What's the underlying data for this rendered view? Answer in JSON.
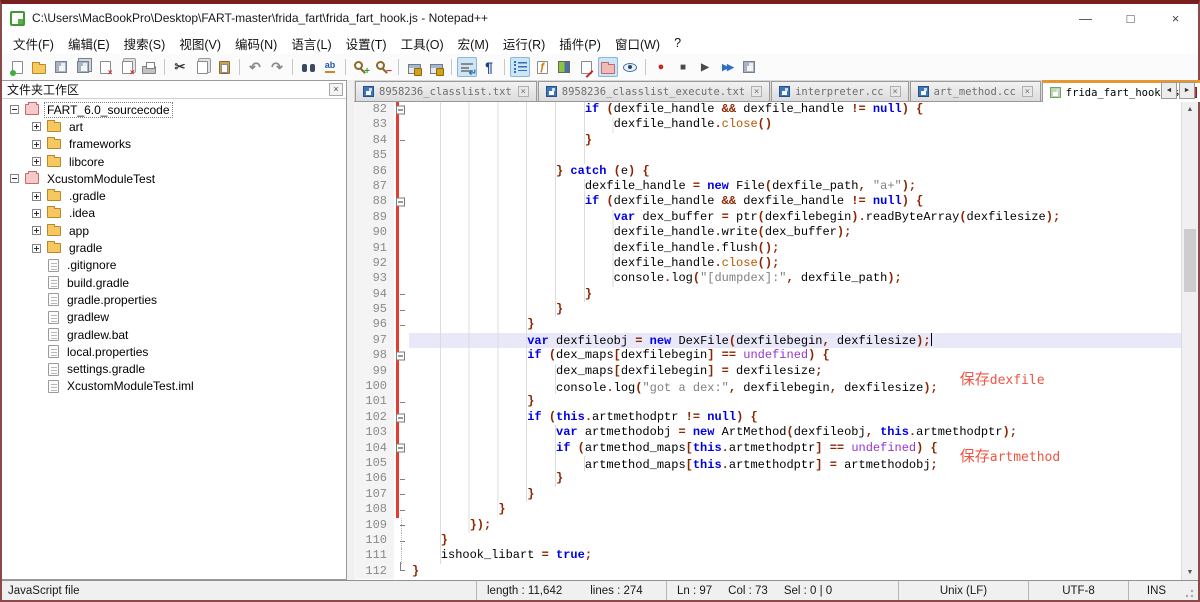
{
  "window": {
    "title": "C:\\Users\\MacBookPro\\Desktop\\FART-master\\frida_fart\\frida_fart_hook.js - Notepad++",
    "minimize": "—",
    "maximize": "□",
    "close": "×"
  },
  "menu": [
    "文件(F)",
    "编辑(E)",
    "搜索(S)",
    "视图(V)",
    "编码(N)",
    "语言(L)",
    "设置(T)",
    "工具(O)",
    "宏(M)",
    "运行(R)",
    "插件(P)",
    "窗口(W)",
    "?"
  ],
  "toolbar": [
    {
      "name": "new-file"
    },
    {
      "name": "open-file"
    },
    {
      "name": "save"
    },
    {
      "name": "save-all"
    },
    {
      "name": "close-file"
    },
    {
      "name": "close-all"
    },
    {
      "name": "print",
      "sep": true
    },
    {
      "name": "cut"
    },
    {
      "name": "copy"
    },
    {
      "name": "paste",
      "sep": true
    },
    {
      "name": "undo"
    },
    {
      "name": "redo",
      "sep": true
    },
    {
      "name": "find"
    },
    {
      "name": "replace",
      "sep": true
    },
    {
      "name": "zoom-in"
    },
    {
      "name": "zoom-out",
      "sep": true
    },
    {
      "name": "sync-vertical"
    },
    {
      "name": "sync-horizontal",
      "sep": true
    },
    {
      "name": "word-wrap",
      "active": true
    },
    {
      "name": "show-all-characters",
      "sep": true
    },
    {
      "name": "indent-guide",
      "active": true
    },
    {
      "name": "function-list"
    },
    {
      "name": "document-map"
    },
    {
      "name": "document-list"
    },
    {
      "name": "folder-as-workspace",
      "active": true
    },
    {
      "name": "monitoring",
      "sep": true
    },
    {
      "name": "macro-record"
    },
    {
      "name": "macro-stop"
    },
    {
      "name": "macro-playback"
    },
    {
      "name": "macro-run-multiple"
    },
    {
      "name": "macro-save"
    }
  ],
  "panel": {
    "title": "文件夹工作区",
    "close": "×",
    "tree": [
      {
        "label": "FART_6.0_sourcecode",
        "type": "root",
        "expand": "minus",
        "focused": true
      },
      {
        "label": "art",
        "type": "folder",
        "expand": "plus"
      },
      {
        "label": "frameworks",
        "type": "folder",
        "expand": "plus"
      },
      {
        "label": "libcore",
        "type": "folder",
        "expand": "plus"
      },
      {
        "label": "XcustomModuleTest",
        "type": "root",
        "expand": "minus"
      },
      {
        "label": ".gradle",
        "type": "folder",
        "expand": "plus"
      },
      {
        "label": ".idea",
        "type": "folder",
        "expand": "plus"
      },
      {
        "label": "app",
        "type": "folder",
        "expand": "plus"
      },
      {
        "label": "gradle",
        "type": "folder",
        "expand": "plus"
      },
      {
        "label": ".gitignore",
        "type": "file"
      },
      {
        "label": "build.gradle",
        "type": "file"
      },
      {
        "label": "gradle.properties",
        "type": "file"
      },
      {
        "label": "gradlew",
        "type": "file"
      },
      {
        "label": "gradlew.bat",
        "type": "file"
      },
      {
        "label": "local.properties",
        "type": "file"
      },
      {
        "label": "settings.gradle",
        "type": "file"
      },
      {
        "label": "XcustomModuleTest.iml",
        "type": "file"
      }
    ]
  },
  "tabs": {
    "items": [
      {
        "label": "8958236_classlist.txt"
      },
      {
        "label": "8958236_classlist_execute.txt"
      },
      {
        "label": "interpreter.cc"
      },
      {
        "label": "art_method.cc"
      },
      {
        "label": "frida_fart_hook.js",
        "active": true
      }
    ],
    "scroll_left": "◄",
    "scroll_right": "►",
    "close_glyph": "×"
  },
  "editor": {
    "lines": [
      {
        "n": 82,
        "i": 24,
        "f": "box",
        "r": true,
        "seg": [
          [
            "k",
            "if"
          ],
          [
            "d",
            " "
          ],
          [
            "o",
            "("
          ],
          [
            "d",
            "dexfile_handle "
          ],
          [
            "o",
            "&&"
          ],
          [
            "d",
            " dexfile_handle "
          ],
          [
            "o",
            "!="
          ],
          [
            "d",
            " "
          ],
          [
            "k",
            "null"
          ],
          [
            "o",
            ")"
          ],
          [
            "d",
            " "
          ],
          [
            "o",
            "{"
          ]
        ]
      },
      {
        "n": 83,
        "i": 28,
        "r": true,
        "seg": [
          [
            "d",
            "dexfile_handle"
          ],
          [
            "o",
            "."
          ],
          [
            "b",
            "close"
          ],
          [
            "o",
            "()"
          ]
        ]
      },
      {
        "n": 84,
        "i": 24,
        "f": "tick",
        "r": true,
        "seg": [
          [
            "o",
            "}"
          ]
        ]
      },
      {
        "n": 85,
        "i": 24,
        "r": true,
        "seg": []
      },
      {
        "n": 86,
        "i": 20,
        "r": true,
        "seg": [
          [
            "o",
            "}"
          ],
          [
            "d",
            " "
          ],
          [
            "k",
            "catch"
          ],
          [
            "d",
            " "
          ],
          [
            "o",
            "("
          ],
          [
            "d",
            "e"
          ],
          [
            "o",
            ")"
          ],
          [
            "d",
            " "
          ],
          [
            "o",
            "{"
          ]
        ]
      },
      {
        "n": 87,
        "i": 24,
        "r": true,
        "seg": [
          [
            "d",
            "dexfile_handle "
          ],
          [
            "o",
            "="
          ],
          [
            "d",
            " "
          ],
          [
            "k",
            "new"
          ],
          [
            "d",
            " File"
          ],
          [
            "o",
            "("
          ],
          [
            "d",
            "dexfile_path"
          ],
          [
            "o",
            ","
          ],
          [
            "d",
            " "
          ],
          [
            "s",
            "\"a+\""
          ],
          [
            "o",
            ");"
          ]
        ]
      },
      {
        "n": 88,
        "i": 24,
        "f": "box",
        "r": true,
        "seg": [
          [
            "k",
            "if"
          ],
          [
            "d",
            " "
          ],
          [
            "o",
            "("
          ],
          [
            "d",
            "dexfile_handle "
          ],
          [
            "o",
            "&&"
          ],
          [
            "d",
            " dexfile_handle "
          ],
          [
            "o",
            "!="
          ],
          [
            "d",
            " "
          ],
          [
            "k",
            "null"
          ],
          [
            "o",
            ")"
          ],
          [
            "d",
            " "
          ],
          [
            "o",
            "{"
          ]
        ]
      },
      {
        "n": 89,
        "i": 28,
        "r": true,
        "seg": [
          [
            "k",
            "var"
          ],
          [
            "d",
            " dex_buffer "
          ],
          [
            "o",
            "="
          ],
          [
            "d",
            " ptr"
          ],
          [
            "o",
            "("
          ],
          [
            "d",
            "dexfilebegin"
          ],
          [
            "o",
            ")."
          ],
          [
            "d",
            "readByteArray"
          ],
          [
            "o",
            "("
          ],
          [
            "d",
            "dexfilesize"
          ],
          [
            "o",
            ");"
          ]
        ]
      },
      {
        "n": 90,
        "i": 28,
        "r": true,
        "seg": [
          [
            "d",
            "dexfile_handle"
          ],
          [
            "o",
            "."
          ],
          [
            "d",
            "write"
          ],
          [
            "o",
            "("
          ],
          [
            "d",
            "dex_buffer"
          ],
          [
            "o",
            ");"
          ]
        ]
      },
      {
        "n": 91,
        "i": 28,
        "r": true,
        "seg": [
          [
            "d",
            "dexfile_handle"
          ],
          [
            "o",
            "."
          ],
          [
            "d",
            "flush"
          ],
          [
            "o",
            "();"
          ]
        ]
      },
      {
        "n": 92,
        "i": 28,
        "r": true,
        "seg": [
          [
            "d",
            "dexfile_handle"
          ],
          [
            "o",
            "."
          ],
          [
            "b",
            "close"
          ],
          [
            "o",
            "();"
          ]
        ]
      },
      {
        "n": 93,
        "i": 28,
        "r": true,
        "seg": [
          [
            "d",
            "console"
          ],
          [
            "o",
            "."
          ],
          [
            "d",
            "log"
          ],
          [
            "o",
            "("
          ],
          [
            "s",
            "\"[dumpdex]:\""
          ],
          [
            "o",
            ","
          ],
          [
            "d",
            " dexfile_path"
          ],
          [
            "o",
            ");"
          ]
        ]
      },
      {
        "n": 94,
        "i": 24,
        "f": "tick",
        "r": true,
        "seg": [
          [
            "o",
            "}"
          ]
        ]
      },
      {
        "n": 95,
        "i": 20,
        "f": "tick",
        "r": true,
        "seg": [
          [
            "o",
            "}"
          ]
        ]
      },
      {
        "n": 96,
        "i": 16,
        "f": "tick",
        "r": true,
        "seg": [
          [
            "o",
            "}"
          ]
        ]
      },
      {
        "n": 97,
        "i": 16,
        "r": true,
        "hl": true,
        "caret": true,
        "seg": [
          [
            "k",
            "var"
          ],
          [
            "d",
            " dexfileobj "
          ],
          [
            "o",
            "="
          ],
          [
            "d",
            " "
          ],
          [
            "k",
            "new"
          ],
          [
            "d",
            " DexFile"
          ],
          [
            "o",
            "("
          ],
          [
            "d",
            "dexfilebegin"
          ],
          [
            "o",
            ","
          ],
          [
            "d",
            " dexfilesize"
          ],
          [
            "o",
            ");"
          ]
        ]
      },
      {
        "n": 98,
        "i": 16,
        "f": "box",
        "r": true,
        "seg": [
          [
            "k",
            "if"
          ],
          [
            "d",
            " "
          ],
          [
            "o",
            "("
          ],
          [
            "d",
            "dex_maps"
          ],
          [
            "o",
            "["
          ],
          [
            "d",
            "dexfilebegin"
          ],
          [
            "o",
            "]"
          ],
          [
            "d",
            " "
          ],
          [
            "o",
            "=="
          ],
          [
            "d",
            " "
          ],
          [
            "u",
            "undefined"
          ],
          [
            "o",
            ")"
          ],
          [
            "d",
            " "
          ],
          [
            "o",
            "{"
          ]
        ]
      },
      {
        "n": 99,
        "i": 20,
        "r": true,
        "seg": [
          [
            "d",
            "dex_maps"
          ],
          [
            "o",
            "["
          ],
          [
            "d",
            "dexfilebegin"
          ],
          [
            "o",
            "]"
          ],
          [
            "d",
            " "
          ],
          [
            "o",
            "="
          ],
          [
            "d",
            " dexfilesize"
          ],
          [
            "o",
            ";"
          ]
        ]
      },
      {
        "n": 100,
        "i": 20,
        "r": true,
        "ann": {
          "cjk": "保存",
          "latin": "dexfile"
        },
        "seg": [
          [
            "d",
            "console"
          ],
          [
            "o",
            "."
          ],
          [
            "d",
            "log"
          ],
          [
            "o",
            "("
          ],
          [
            "s",
            "\"got a dex:\""
          ],
          [
            "o",
            ","
          ],
          [
            "d",
            " dexfilebegin"
          ],
          [
            "o",
            ","
          ],
          [
            "d",
            " dexfilesize"
          ],
          [
            "o",
            ");"
          ]
        ]
      },
      {
        "n": 101,
        "i": 16,
        "f": "tick",
        "r": true,
        "seg": [
          [
            "o",
            "}"
          ]
        ]
      },
      {
        "n": 102,
        "i": 16,
        "f": "box",
        "r": true,
        "seg": [
          [
            "k",
            "if"
          ],
          [
            "d",
            " "
          ],
          [
            "o",
            "("
          ],
          [
            "k",
            "this"
          ],
          [
            "o",
            "."
          ],
          [
            "d",
            "artmethodptr "
          ],
          [
            "o",
            "!="
          ],
          [
            "d",
            " "
          ],
          [
            "k",
            "null"
          ],
          [
            "o",
            ")"
          ],
          [
            "d",
            " "
          ],
          [
            "o",
            "{"
          ]
        ]
      },
      {
        "n": 103,
        "i": 20,
        "r": true,
        "seg": [
          [
            "k",
            "var"
          ],
          [
            "d",
            " artmethodobj "
          ],
          [
            "o",
            "="
          ],
          [
            "d",
            " "
          ],
          [
            "k",
            "new"
          ],
          [
            "d",
            " ArtMethod"
          ],
          [
            "o",
            "("
          ],
          [
            "d",
            "dexfileobj"
          ],
          [
            "o",
            ","
          ],
          [
            "d",
            " "
          ],
          [
            "k",
            "this"
          ],
          [
            "o",
            "."
          ],
          [
            "d",
            "artmethodptr"
          ],
          [
            "o",
            ");"
          ]
        ]
      },
      {
        "n": 104,
        "i": 20,
        "f": "box",
        "r": true,
        "seg": [
          [
            "k",
            "if"
          ],
          [
            "d",
            " "
          ],
          [
            "o",
            "("
          ],
          [
            "d",
            "artmethod_maps"
          ],
          [
            "o",
            "["
          ],
          [
            "k",
            "this"
          ],
          [
            "o",
            "."
          ],
          [
            "d",
            "artmethodptr"
          ],
          [
            "o",
            "]"
          ],
          [
            "d",
            " "
          ],
          [
            "o",
            "=="
          ],
          [
            "d",
            " "
          ],
          [
            "u",
            "undefined"
          ],
          [
            "o",
            ")"
          ],
          [
            "d",
            " "
          ],
          [
            "o",
            "{"
          ]
        ]
      },
      {
        "n": 105,
        "i": 24,
        "r": true,
        "ann": {
          "cjk": "保存",
          "latin": "artmethod"
        },
        "seg": [
          [
            "d",
            "artmethod_maps"
          ],
          [
            "o",
            "["
          ],
          [
            "k",
            "this"
          ],
          [
            "o",
            "."
          ],
          [
            "d",
            "artmethodptr"
          ],
          [
            "o",
            "]"
          ],
          [
            "d",
            " "
          ],
          [
            "o",
            "="
          ],
          [
            "d",
            " artmethodobj"
          ],
          [
            "o",
            ";"
          ]
        ]
      },
      {
        "n": 106,
        "i": 20,
        "f": "tick",
        "r": true,
        "seg": [
          [
            "o",
            "}"
          ]
        ]
      },
      {
        "n": 107,
        "i": 16,
        "f": "tick",
        "r": true,
        "seg": [
          [
            "o",
            "}"
          ]
        ]
      },
      {
        "n": 108,
        "i": 12,
        "f": "tick",
        "r": true,
        "seg": [
          [
            "o",
            "}"
          ]
        ]
      },
      {
        "n": 109,
        "i": 8,
        "f": "tick",
        "g": true,
        "seg": [
          [
            "o",
            "});"
          ]
        ]
      },
      {
        "n": 110,
        "i": 4,
        "f": "tick",
        "g": true,
        "seg": [
          [
            "o",
            "}"
          ]
        ]
      },
      {
        "n": 111,
        "i": 4,
        "g": true,
        "seg": [
          [
            "d",
            "ishook_libart "
          ],
          [
            "o",
            "="
          ],
          [
            "d",
            " "
          ],
          [
            "k",
            "true"
          ],
          [
            "o",
            ";"
          ]
        ]
      },
      {
        "n": 112,
        "i": 0,
        "f": "corner",
        "seg": [
          [
            "o",
            "}"
          ]
        ]
      }
    ]
  },
  "status": {
    "doc_type": "JavaScript file",
    "length": "length : 11,642",
    "lines": "lines : 274",
    "ln": "Ln : 97",
    "col": "Col : 73",
    "sel": "Sel : 0 | 0",
    "eol": "Unix (LF)",
    "encoding": "UTF-8",
    "insert_mode": "INS"
  },
  "colors": {
    "keyword": "#0000e8",
    "operator": "#8b2500",
    "string": "#808080",
    "undefined_word": "#9933cc",
    "method_brown": "#b35900",
    "annotation": "#ee5544",
    "active_tab_accent": "#e8972e",
    "change_bar": "#e63b30",
    "current_line": "#e8e8f8"
  }
}
